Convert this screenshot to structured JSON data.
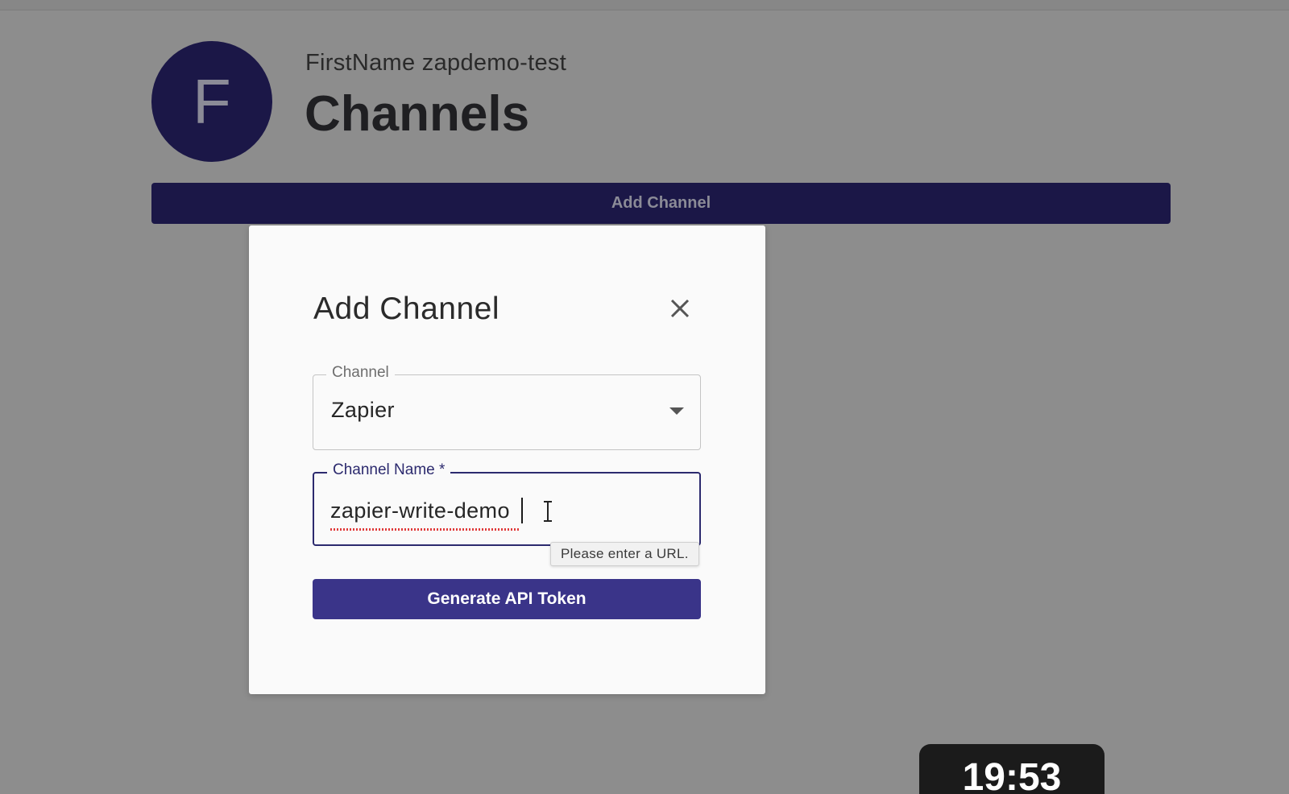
{
  "header": {
    "avatar_initial": "F",
    "username": "FirstName zapdemo-test",
    "title": "Channels"
  },
  "add_channel_bar": {
    "label": "Add Channel"
  },
  "modal": {
    "title": "Add Channel",
    "close_icon": "close-icon",
    "channel_field": {
      "label": "Channel",
      "value": "Zapier",
      "icon": "chevron-down-icon"
    },
    "channel_name_field": {
      "label": "Channel Name *",
      "value": "zapier-write-demo"
    },
    "tooltip": "Please enter a URL.",
    "generate_button": "Generate API Token"
  },
  "timer": {
    "value": "19:53"
  },
  "colors": {
    "overlay": "#8d8d8d",
    "brand_dark": "#1b1747",
    "primary": "#3a3489",
    "field_focus": "#2c2a6e"
  }
}
